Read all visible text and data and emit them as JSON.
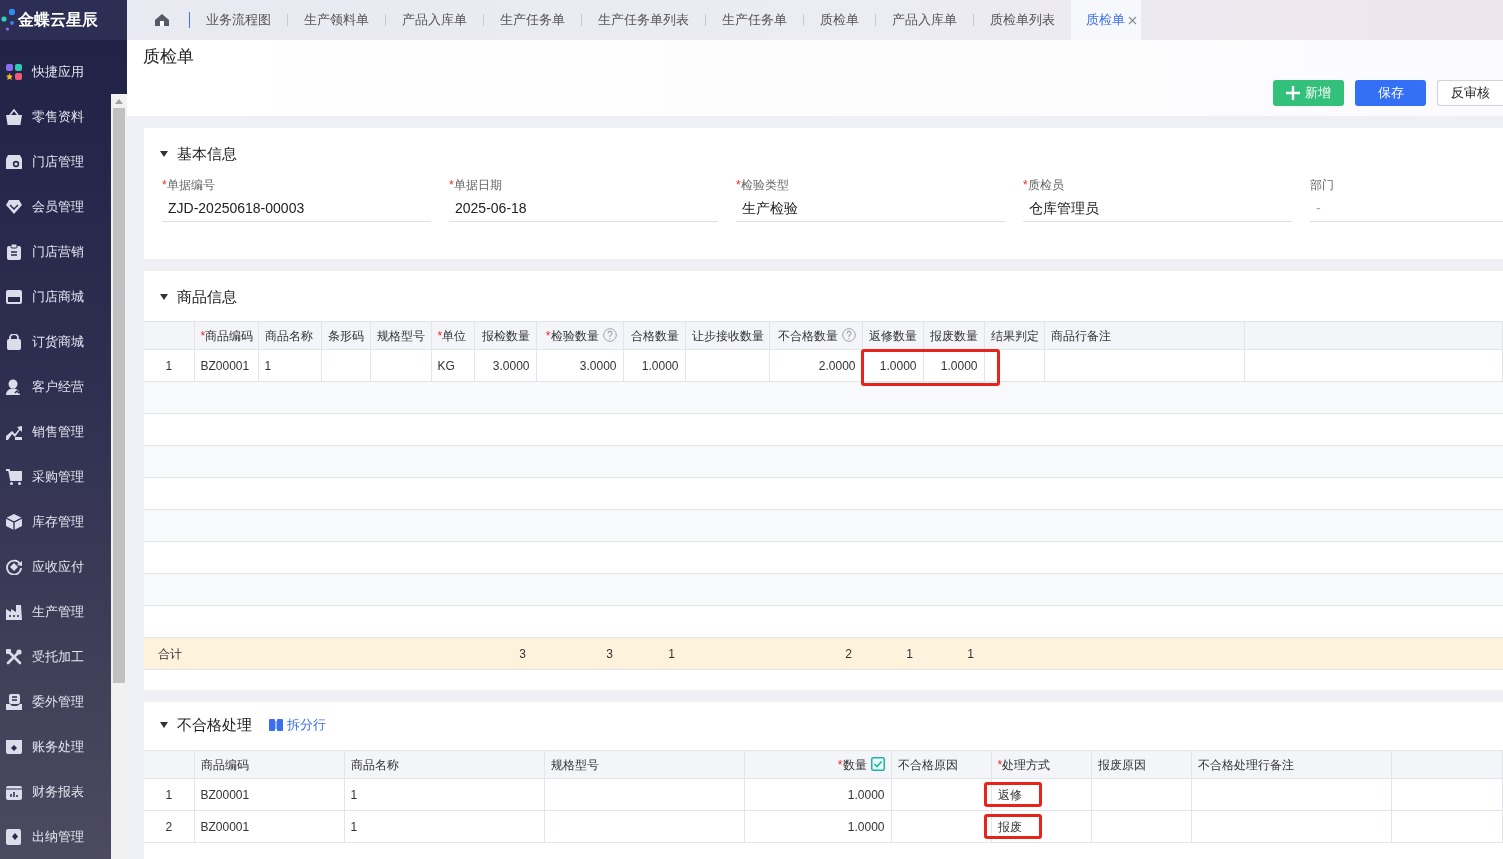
{
  "sidebar": {
    "logo": "金蝶云星辰",
    "items": [
      {
        "label": "快捷应用",
        "selected": false
      },
      {
        "label": "零售资料",
        "selected": false
      },
      {
        "label": "门店管理",
        "selected": false
      },
      {
        "label": "会员管理",
        "selected": false
      },
      {
        "label": "门店营销",
        "selected": false
      },
      {
        "label": "门店商城",
        "selected": false
      },
      {
        "label": "订货商城",
        "selected": false
      },
      {
        "label": "客户经营",
        "selected": false
      },
      {
        "label": "销售管理",
        "selected": false
      },
      {
        "label": "采购管理",
        "selected": false
      },
      {
        "label": "库存管理",
        "selected": false
      },
      {
        "label": "应收应付",
        "selected": false
      },
      {
        "label": "生产管理",
        "selected": false
      },
      {
        "label": "受托加工",
        "selected": false
      },
      {
        "label": "委外管理",
        "selected": false
      },
      {
        "label": "账务处理",
        "selected": false
      },
      {
        "label": "财务报表",
        "selected": false
      },
      {
        "label": "出纳管理",
        "selected": false
      }
    ]
  },
  "tabs": [
    {
      "label": "业务流程图",
      "selected": false
    },
    {
      "label": "生产领料单",
      "selected": false
    },
    {
      "label": "产品入库单",
      "selected": false
    },
    {
      "label": "生产任务单",
      "selected": false
    },
    {
      "label": "生产任务单列表",
      "selected": false
    },
    {
      "label": "生产任务单",
      "selected": false
    },
    {
      "label": "质检单",
      "selected": false
    },
    {
      "label": "产品入库单",
      "selected": false
    },
    {
      "label": "质检单列表",
      "selected": false
    },
    {
      "label": "质检单",
      "selected": true
    }
  ],
  "page": {
    "title": "质检单",
    "buttons": [
      {
        "label": "新增",
        "kind": "add"
      },
      {
        "label": "保存",
        "kind": "primary"
      },
      {
        "label": "反审核",
        "kind": "default"
      }
    ]
  },
  "basic_info": {
    "title": "基本信息",
    "expanded": true,
    "fields": [
      {
        "mark": "*",
        "label": "单据编号",
        "value": "ZJD-20250618-00003"
      },
      {
        "mark": "*",
        "label": "单据日期",
        "value": "2025-06-18"
      },
      {
        "mark": "*",
        "label": "检验类型",
        "value": "生产检验"
      },
      {
        "mark": "*",
        "label": "质检员",
        "value": "仓库管理员"
      },
      {
        "label": "部门",
        "placeholder": "-"
      }
    ]
  },
  "products": {
    "title": "商品信息",
    "expanded": true,
    "columns": [
      {
        "mark": "*",
        "label": "商品编码",
        "kind": "text"
      },
      {
        "label": "商品名称",
        "kind": "text"
      },
      {
        "label": "条形码",
        "kind": "text"
      },
      {
        "label": "规格型号",
        "kind": "text"
      },
      {
        "mark": "*",
        "label": "单位",
        "kind": "text"
      },
      {
        "label": "报检数量",
        "kind": "number"
      },
      {
        "mark": "*",
        "label": "检验数量",
        "kind": "number",
        "help": true
      },
      {
        "label": "合格数量",
        "kind": "number"
      },
      {
        "label": "让步接收数量",
        "kind": "number"
      },
      {
        "label": "不合格数量",
        "kind": "number",
        "help": true
      },
      {
        "label": "返修数量",
        "kind": "number"
      },
      {
        "label": "报废数量",
        "kind": "number"
      },
      {
        "label": "结果判定",
        "kind": "text"
      },
      {
        "label": "商品行备注",
        "kind": "text"
      }
    ],
    "rows": [
      {
        "number": "1",
        "cells": [
          "BZ00001",
          "1",
          null,
          null,
          "KG",
          "3.0000",
          "3.0000",
          "1.0000",
          null,
          "2.0000",
          {
            "text": "1.0000",
            "highlighted": true
          },
          {
            "text": "1.0000",
            "highlighted": true
          },
          null,
          null
        ]
      }
    ],
    "totals": {
      "label": "合计",
      "cells": [
        null,
        null,
        null,
        null,
        null,
        "3",
        "3",
        "1",
        null,
        "2",
        "1",
        "1",
        null,
        null
      ]
    }
  },
  "defects": {
    "title": "不合格处理",
    "expanded": true,
    "action": "拆分行",
    "columns": [
      {
        "label": "商品编码",
        "kind": "text"
      },
      {
        "label": "商品名称",
        "kind": "text"
      },
      {
        "label": "规格型号",
        "kind": "text"
      },
      {
        "mark": "*",
        "label": "数量",
        "kind": "number",
        "checked": true
      },
      {
        "label": "不合格原因",
        "kind": "text"
      },
      {
        "mark": "*",
        "label": "处理方式",
        "kind": "text"
      },
      {
        "label": "报废原因",
        "kind": "text"
      },
      {
        "label": "不合格处理行备注",
        "kind": "text"
      }
    ],
    "rows": [
      {
        "number": "1",
        "cells": [
          "BZ00001",
          "1",
          null,
          "1.0000",
          null,
          {
            "text": "返修",
            "highlighted": true
          },
          null,
          null
        ]
      },
      {
        "number": "2",
        "cells": [
          "BZ00001",
          "1",
          null,
          "1.0000",
          null,
          {
            "text": "报废",
            "highlighted": true
          },
          null,
          null
        ]
      }
    ]
  }
}
